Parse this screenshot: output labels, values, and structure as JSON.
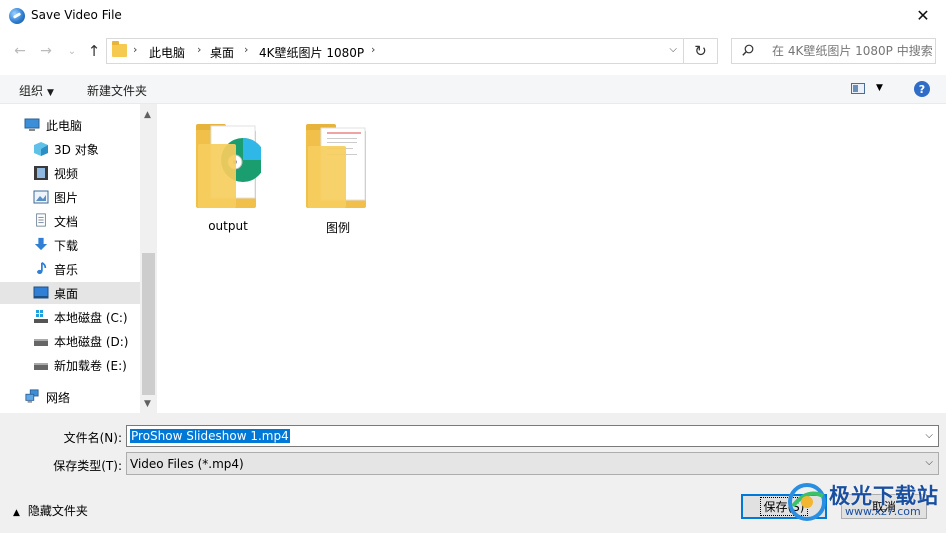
{
  "window": {
    "title": "Save Video File",
    "close_symbol": "✕"
  },
  "address": {
    "back": "←",
    "forward": "→",
    "recent": "⌄",
    "up": "↑",
    "crumbs": [
      "此电脑",
      "桌面",
      "4K壁纸图片 1080P"
    ],
    "separator": "›",
    "dropdown": "⌵",
    "refresh": "↻"
  },
  "search": {
    "placeholder": "在 4K壁纸图片 1080P 中搜索"
  },
  "commandbar": {
    "organize": "组织",
    "organize_caret": "▼",
    "new_folder": "新建文件夹",
    "view_caret": "▼",
    "help": "?"
  },
  "sidebar": {
    "items": [
      {
        "label": "此电脑",
        "icon": "computer-icon"
      },
      {
        "label": "3D 对象",
        "icon": "cube-3d-icon"
      },
      {
        "label": "视频",
        "icon": "video-icon"
      },
      {
        "label": "图片",
        "icon": "picture-icon"
      },
      {
        "label": "文档",
        "icon": "document-icon"
      },
      {
        "label": "下载",
        "icon": "download-icon"
      },
      {
        "label": "音乐",
        "icon": "music-icon"
      },
      {
        "label": "桌面",
        "icon": "desktop-icon",
        "selected": true
      },
      {
        "label": "本地磁盘 (C:)",
        "icon": "drive-windows-icon"
      },
      {
        "label": "本地磁盘 (D:)",
        "icon": "drive-icon"
      },
      {
        "label": "新加载卷 (E:)",
        "icon": "drive-icon"
      },
      {
        "label": "网络",
        "icon": "network-icon"
      }
    ],
    "scroll_up": "▲",
    "scroll_down": "▼"
  },
  "files": [
    {
      "name": "output",
      "icon": "folder-icon"
    },
    {
      "name": "图例",
      "icon": "folder-icon"
    }
  ],
  "form": {
    "filename_label": "文件名(N):",
    "filename_value": "ProShow Slideshow 1.mp4",
    "filetype_label": "保存类型(T):",
    "filetype_value": "Video Files (*.mp4)",
    "dropdown_symbol": "⌵"
  },
  "footer": {
    "hide_folders": "隐藏文件夹",
    "hide_caret": "▲",
    "save": "保存(S)",
    "cancel": "取消"
  },
  "watermark": {
    "text": "极光下载站",
    "sub": "www.xz7.com"
  },
  "colors": {
    "accent": "#0078d7",
    "folder": "#f6c94f",
    "selected_row": "#e5e5e5",
    "bottom_bg": "#f0f0f0"
  }
}
